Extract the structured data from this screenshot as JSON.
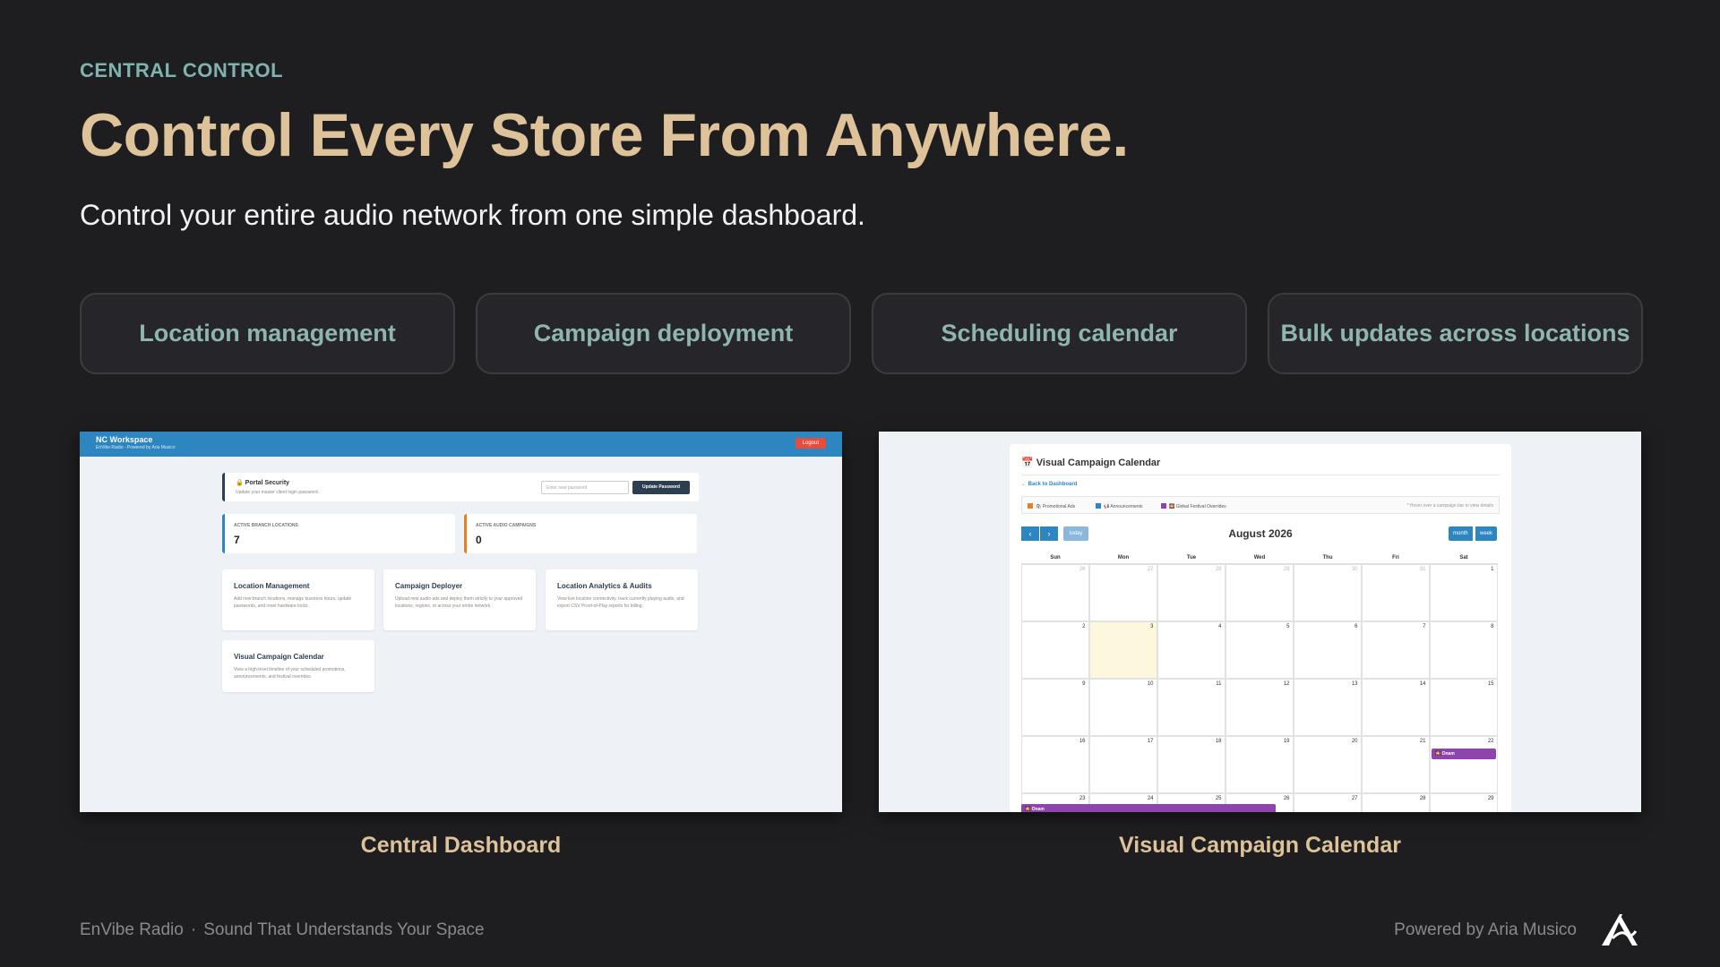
{
  "header": {
    "eyebrow": "CENTRAL CONTROL",
    "headline": "Control Every Store From Anywhere.",
    "subline": "Control your entire audio network from one simple dashboard."
  },
  "features": [
    "Location management",
    "Campaign deployment",
    "Scheduling calendar",
    "Bulk updates across locations"
  ],
  "captions": {
    "left": "Central Dashboard",
    "right": "Visual Campaign Calendar"
  },
  "footer": {
    "brand": "EnVibe Radio",
    "separator": "·",
    "tagline": "Sound That Understands Your Space",
    "powered": "Powered by Aria Musico",
    "logo_icon": "aria-musico-logo-icon"
  },
  "dashboard": {
    "title": "NC Workspace",
    "subtitle": "EnVibe Radio - Powered by Aria Musico",
    "logout": "Logout",
    "security_title": "🔒 Portal Security",
    "security_sub": "Update your master client login password.",
    "password_placeholder": "Enter new password",
    "update_button": "Update Password",
    "stats": [
      {
        "label": "ACTIVE BRANCH LOCATIONS",
        "value": "7",
        "color": "#2e86c1"
      },
      {
        "label": "ACTIVE AUDIO CAMPAIGNS",
        "value": "0",
        "color": "#e67e22"
      }
    ],
    "cards": [
      {
        "title": "Location Management",
        "desc": "Add new branch locations, manage business hours, update passwords, and reset hardware locks."
      },
      {
        "title": "Campaign Deployer",
        "desc": "Upload new audio ads and deploy them strictly to your approved locations, regions, or across your entire network."
      },
      {
        "title": "Location Analytics & Audits",
        "desc": "View live location connectivity, track currently playing audio, and export CSV Proof-of-Play reports for billing."
      },
      {
        "title": "Visual Campaign Calendar",
        "desc": "View a high-level timeline of your scheduled promotions, announcements, and festival overrides."
      }
    ]
  },
  "calendar": {
    "title": "📅 Visual Campaign Calendar",
    "back": "← Back to Dashboard",
    "legend": [
      {
        "label": "🛍 Promotional Ads",
        "color": "#e67e22"
      },
      {
        "label": "📢 Announcements",
        "color": "#2e86c1"
      },
      {
        "label": "🎇 Global Festival Overrides",
        "color": "#8e44ad"
      }
    ],
    "hint": "* Hover over a campaign bar to view details",
    "prev": "‹",
    "next": "›",
    "today": "today",
    "month_title": "August 2026",
    "view_month": "month",
    "view_week": "week",
    "dow": [
      "Sun",
      "Mon",
      "Tue",
      "Wed",
      "Thu",
      "Fri",
      "Sat"
    ],
    "weeks": [
      [
        "26",
        "27",
        "28",
        "29",
        "30",
        "31",
        "1"
      ],
      [
        "2",
        "3",
        "4",
        "5",
        "6",
        "7",
        "8"
      ],
      [
        "9",
        "10",
        "11",
        "12",
        "13",
        "14",
        "15"
      ],
      [
        "16",
        "17",
        "18",
        "19",
        "20",
        "21",
        "22"
      ],
      [
        "23",
        "24",
        "25",
        "26",
        "27",
        "28",
        "29"
      ]
    ],
    "highlight_day": "3",
    "event_label": "🎇 Onam",
    "event_color": "#8e44ad"
  }
}
